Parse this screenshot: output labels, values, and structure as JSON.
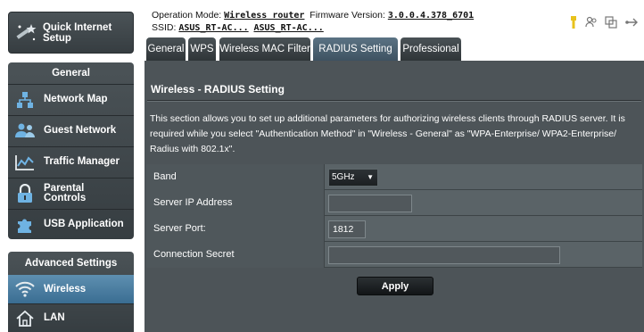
{
  "header": {
    "op_mode_label": "Operation Mode:",
    "op_mode_value": "Wireless router",
    "fw_label": "Firmware Version:",
    "fw_value": "3.0.0.4.378_6701",
    "ssid_label": "SSID:",
    "ssid_1": "ASUS_RT-AC...",
    "ssid_2": "ASUS_RT-AC...",
    "icons": [
      "usb-icon",
      "users-icon",
      "copy-icon",
      "network-icon"
    ]
  },
  "sidebar": {
    "quick_setup": "Quick Internet Setup",
    "general_title": "General",
    "items": [
      {
        "label": "Network Map",
        "icon": "network-map-icon"
      },
      {
        "label": "Guest Network",
        "icon": "guest-network-icon"
      },
      {
        "label": "Traffic Manager",
        "icon": "traffic-manager-icon"
      },
      {
        "label": "Parental Controls",
        "icon": "lock-icon"
      },
      {
        "label": "USB Application",
        "icon": "puzzle-icon"
      }
    ],
    "advanced_title": "Advanced Settings",
    "advanced_items": [
      {
        "label": "Wireless",
        "icon": "wifi-icon",
        "active": true
      },
      {
        "label": "LAN",
        "icon": "home-icon"
      }
    ]
  },
  "tabs": [
    {
      "label": "General"
    },
    {
      "label": "WPS"
    },
    {
      "label": "Wireless MAC Filter"
    },
    {
      "label": "RADIUS Setting",
      "active": true
    },
    {
      "label": "Professional"
    }
  ],
  "panel": {
    "title": "Wireless - RADIUS Setting",
    "description": "This section allows you to set up additional parameters for authorizing wireless clients through RADIUS server. It is required while you select \"Authentication Method\" in \"Wireless - General\" as \"WPA-Enterprise/ WPA2-Enterprise/ Radius with 802.1x\".",
    "fields": {
      "band_label": "Band",
      "band_value": "5GHz",
      "server_ip_label": "Server IP Address",
      "server_ip_value": "",
      "server_port_label": "Server Port:",
      "server_port_value": "1812",
      "secret_label": "Connection Secret",
      "secret_value": ""
    },
    "apply_label": "Apply"
  },
  "colors": {
    "panel_bg": "#4d5458",
    "active_blue": "#3a6d92",
    "usb_icon": "#e8c21c"
  }
}
